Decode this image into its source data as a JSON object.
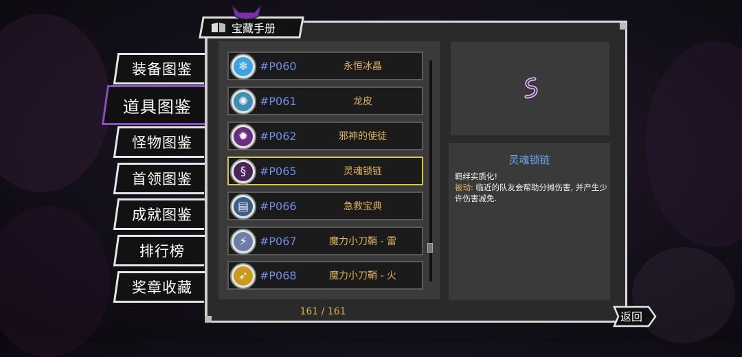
{
  "title": "宝藏手册",
  "sidebar": {
    "items": [
      {
        "label": "装备图鉴",
        "active": false
      },
      {
        "label": "道具图鉴",
        "active": true
      },
      {
        "label": "怪物图鉴",
        "active": false
      },
      {
        "label": "首领图鉴",
        "active": false
      },
      {
        "label": "成就图鉴",
        "active": false
      },
      {
        "label": "排行榜",
        "active": false
      },
      {
        "label": "奖章收藏",
        "active": false
      }
    ]
  },
  "items": [
    {
      "code": "#P060",
      "name": "永恒冰晶",
      "icon": "snowflake-icon",
      "glyph": "❄",
      "color": "#3aa3e0"
    },
    {
      "code": "#P061",
      "name": "龙皮",
      "icon": "dragon-skin-icon",
      "glyph": "✺",
      "color": "#3c8fb0"
    },
    {
      "code": "#P062",
      "name": "邪神的使徒",
      "icon": "evil-apostle-icon",
      "glyph": "✹",
      "color": "#6b2d7d"
    },
    {
      "code": "#P065",
      "name": "灵魂锁链",
      "icon": "soul-chain-icon",
      "glyph": "§",
      "color": "#4a2458",
      "selected": true
    },
    {
      "code": "#P066",
      "name": "急救宝典",
      "icon": "first-aid-book-icon",
      "glyph": "▤",
      "color": "#3a5f86"
    },
    {
      "code": "#P067",
      "name": "魔力小刀鞘 - 雷",
      "icon": "thunder-sheath-icon",
      "glyph": "⚡",
      "color": "#6d7fa8"
    },
    {
      "code": "#P068",
      "name": "魔力小刀鞘 - 火",
      "icon": "fire-sheath-icon",
      "glyph": "➶",
      "color": "#c99a1c"
    }
  ],
  "pager": "161 / 161",
  "detail": {
    "title": "灵魂锁链",
    "line1": "羁绊实质化!",
    "label": "被动:",
    "text": " 临近的队友会帮助分摊伤害, 并产生少许伤害减免."
  },
  "back_label": "返回",
  "colors": {
    "accent": "#8a4fc4",
    "highlight": "#d4c64a",
    "code": "#6f8fe8",
    "name": "#e0b458"
  }
}
